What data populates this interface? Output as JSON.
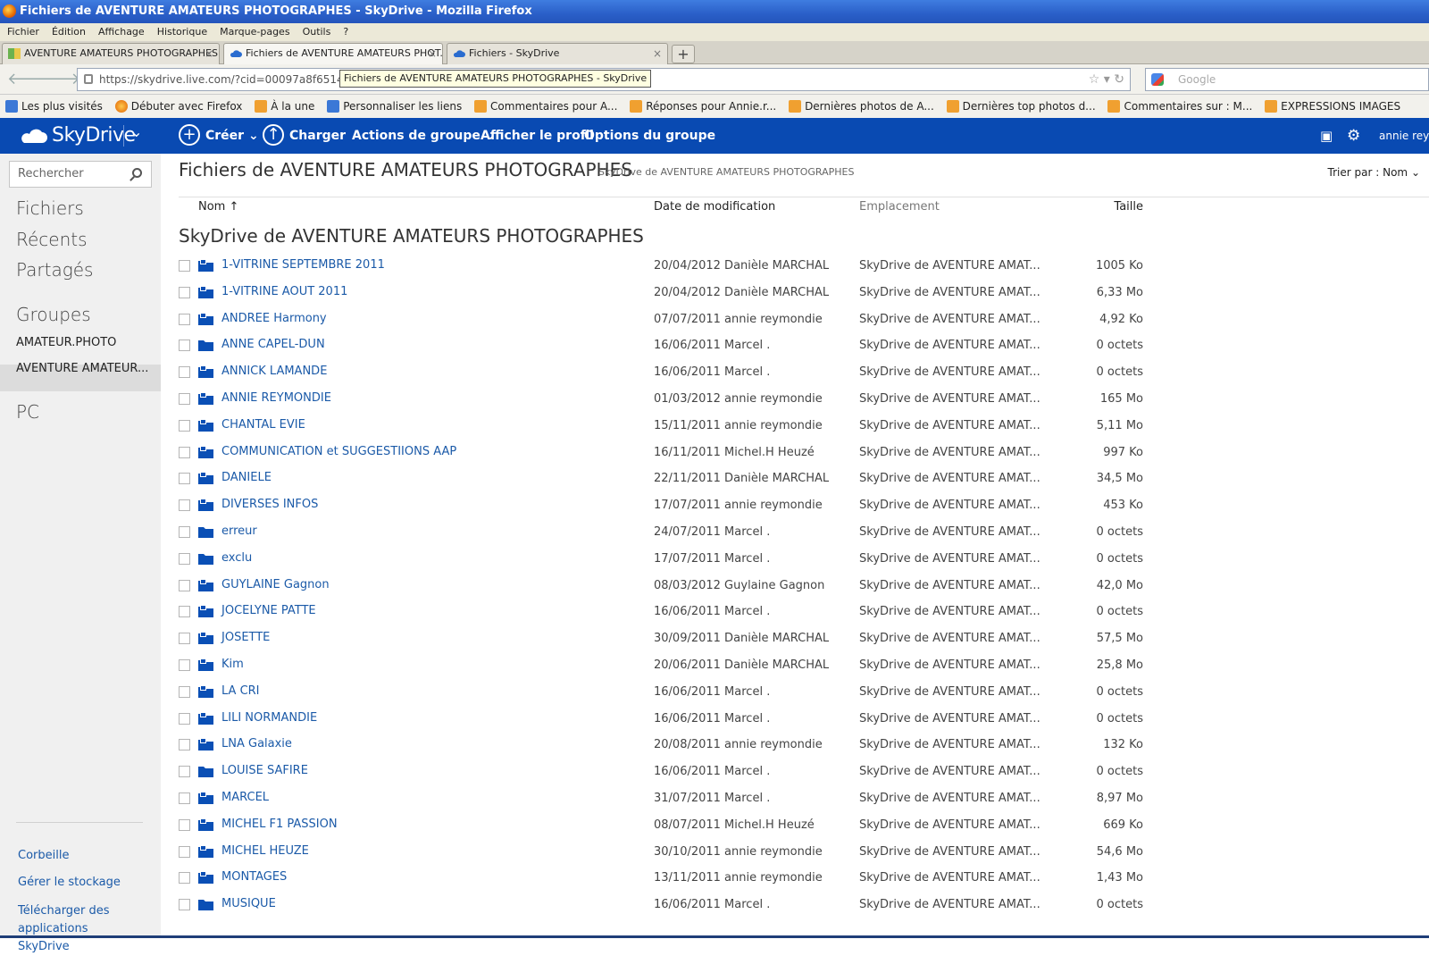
{
  "window": {
    "title": "Fichiers de AVENTURE AMATEURS PHOTOGRAPHES - SkyDrive - Mozilla Firefox"
  },
  "menu": [
    "Fichier",
    "Édition",
    "Affichage",
    "Historique",
    "Marque-pages",
    "Outils",
    "?"
  ],
  "tabs": [
    {
      "label": "AVENTURE AMATEURS PHOTOGRAPHES ...",
      "active": false
    },
    {
      "label": "Fichiers de AVENTURE AMATEURS PHOT...",
      "active": true
    },
    {
      "label": "Fichiers - SkyDrive",
      "active": false
    }
  ],
  "newtab": "+",
  "nav": {
    "url": "https://skydrive.live.com/?cid=00097a8f65147a",
    "tooltip": "Fichiers de AVENTURE AMATEURS PHOTOGRAPHES - SkyDrive",
    "search_placeholder": "Google"
  },
  "bookmarks": [
    {
      "label": "Les plus visités",
      "icon": "blue"
    },
    {
      "label": "Débuter avec Firefox",
      "icon": "ff"
    },
    {
      "label": "À la une",
      "icon": "rss"
    },
    {
      "label": "Personnaliser les liens",
      "icon": "blue"
    },
    {
      "label": "Commentaires pour A...",
      "icon": "rss"
    },
    {
      "label": "Réponses pour Annie.r...",
      "icon": "rss"
    },
    {
      "label": "Dernières photos de A...",
      "icon": "rss"
    },
    {
      "label": "Dernières top photos d...",
      "icon": "rss"
    },
    {
      "label": "Commentaires sur : M...",
      "icon": "rss"
    },
    {
      "label": "EXPRESSIONS IMAGES",
      "icon": "rss"
    }
  ],
  "appbar": {
    "logo": "SkyDrive",
    "create": "Créer",
    "upload": "Charger",
    "group_actions": "Actions de groupe",
    "view_profile": "Afficher le profil",
    "group_options": "Options du groupe",
    "user": "annie reym",
    "color": "#094ab2"
  },
  "sidebar": {
    "search_placeholder": "Rechercher",
    "files": "Fichiers",
    "recent": "Récents",
    "shared": "Partagés",
    "groups": "Groupes",
    "group1": "AMATEUR.PHOTO",
    "group2": "AVENTURE AMATEUR...",
    "pc": "PC",
    "recycle": "Corbeille",
    "storage": "Gérer le stockage",
    "download_apps": "Télécharger des applications SkyDrive"
  },
  "main": {
    "title": "Fichiers de AVENTURE AMATEURS PHOTOGRAPHES",
    "subtitle": "SkyDrive de AVENTURE AMATEURS PHOTOGRAPHES",
    "sort_by": "Trier par : Nom",
    "col_name": "Nom ↑",
    "col_date": "Date de modification",
    "col_location": "Emplacement",
    "col_size": "Taille",
    "section": "SkyDrive de AVENTURE AMATEURS PHOTOGRAPHES"
  },
  "files": [
    {
      "name": "1-VITRINE SEPTEMBRE 2011",
      "date": "20/04/2012 Danièle MARCHAL",
      "location": "SkyDrive de AVENTURE AMAT...",
      "size": "1005 Ko",
      "shared": true
    },
    {
      "name": "1-VITRINE AOUT 2011",
      "date": "20/04/2012 Danièle MARCHAL",
      "location": "SkyDrive de AVENTURE AMAT...",
      "size": "6,33 Mo",
      "shared": true
    },
    {
      "name": "ANDREE Harmony",
      "date": "07/07/2011 annie reymondie",
      "location": "SkyDrive de AVENTURE AMAT...",
      "size": "4,92 Ko",
      "shared": true
    },
    {
      "name": "ANNE CAPEL-DUN",
      "date": "16/06/2011 Marcel .",
      "location": "SkyDrive de AVENTURE AMAT...",
      "size": "0 octets",
      "shared": false
    },
    {
      "name": "ANNICK LAMANDE",
      "date": "16/06/2011 Marcel .",
      "location": "SkyDrive de AVENTURE AMAT...",
      "size": "0 octets",
      "shared": true
    },
    {
      "name": "ANNIE REYMONDIE",
      "date": "01/03/2012 annie reymondie",
      "location": "SkyDrive de AVENTURE AMAT...",
      "size": "165 Mo",
      "shared": true
    },
    {
      "name": "CHANTAL EVIE",
      "date": "15/11/2011 annie reymondie",
      "location": "SkyDrive de AVENTURE AMAT...",
      "size": "5,11 Mo",
      "shared": true
    },
    {
      "name": "COMMUNICATION et SUGGESTIIONS AAP",
      "date": "16/11/2011 Michel.H Heuzé",
      "location": "SkyDrive de AVENTURE AMAT...",
      "size": "997 Ko",
      "shared": true
    },
    {
      "name": "DANIELE",
      "date": "22/11/2011 Danièle MARCHAL",
      "location": "SkyDrive de AVENTURE AMAT...",
      "size": "34,5 Mo",
      "shared": true
    },
    {
      "name": "DIVERSES INFOS",
      "date": "17/07/2011 annie reymondie",
      "location": "SkyDrive de AVENTURE AMAT...",
      "size": "453 Ko",
      "shared": true
    },
    {
      "name": "erreur",
      "date": "24/07/2011 Marcel .",
      "location": "SkyDrive de AVENTURE AMAT...",
      "size": "0 octets",
      "shared": false
    },
    {
      "name": "exclu",
      "date": "17/07/2011 Marcel .",
      "location": "SkyDrive de AVENTURE AMAT...",
      "size": "0 octets",
      "shared": false
    },
    {
      "name": "GUYLAINE Gagnon",
      "date": "08/03/2012 Guylaine Gagnon",
      "location": "SkyDrive de AVENTURE AMAT...",
      "size": "42,0 Mo",
      "shared": true
    },
    {
      "name": "JOCELYNE PATTE",
      "date": "16/06/2011 Marcel .",
      "location": "SkyDrive de AVENTURE AMAT...",
      "size": "0 octets",
      "shared": true
    },
    {
      "name": "JOSETTE",
      "date": "30/09/2011 Danièle MARCHAL",
      "location": "SkyDrive de AVENTURE AMAT...",
      "size": "57,5 Mo",
      "shared": true
    },
    {
      "name": "Kim",
      "date": "20/06/2011 Danièle MARCHAL",
      "location": "SkyDrive de AVENTURE AMAT...",
      "size": "25,8 Mo",
      "shared": true
    },
    {
      "name": "LA CRI",
      "date": "16/06/2011 Marcel .",
      "location": "SkyDrive de AVENTURE AMAT...",
      "size": "0 octets",
      "shared": true
    },
    {
      "name": "LILI NORMANDIE",
      "date": "16/06/2011 Marcel .",
      "location": "SkyDrive de AVENTURE AMAT...",
      "size": "0 octets",
      "shared": true
    },
    {
      "name": "LNA Galaxie",
      "date": "20/08/2011 annie reymondie",
      "location": "SkyDrive de AVENTURE AMAT...",
      "size": "132 Ko",
      "shared": true
    },
    {
      "name": "LOUISE SAFIRE",
      "date": "16/06/2011 Marcel .",
      "location": "SkyDrive de AVENTURE AMAT...",
      "size": "0 octets",
      "shared": false
    },
    {
      "name": "MARCEL",
      "date": "31/07/2011 Marcel .",
      "location": "SkyDrive de AVENTURE AMAT...",
      "size": "8,97 Mo",
      "shared": true
    },
    {
      "name": "MICHEL F1 PASSION",
      "date": "08/07/2011 Michel.H Heuzé",
      "location": "SkyDrive de AVENTURE AMAT...",
      "size": "669 Ko",
      "shared": true
    },
    {
      "name": "MICHEL HEUZE",
      "date": "30/10/2011 annie reymondie",
      "location": "SkyDrive de AVENTURE AMAT...",
      "size": "54,6 Mo",
      "shared": true
    },
    {
      "name": "MONTAGES",
      "date": "13/11/2011 annie reymondie",
      "location": "SkyDrive de AVENTURE AMAT...",
      "size": "1,43 Mo",
      "shared": true
    },
    {
      "name": "MUSIQUE",
      "date": "16/06/2011 Marcel .",
      "location": "SkyDrive de AVENTURE AMAT...",
      "size": "0 octets",
      "shared": false
    }
  ]
}
